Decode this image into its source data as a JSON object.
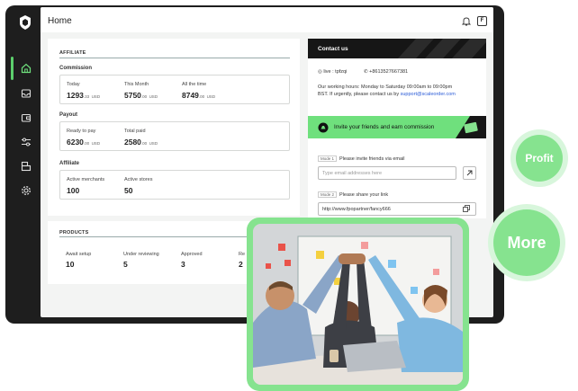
{
  "header": {
    "title": "Home",
    "profile_initial": "F"
  },
  "sidebar": {
    "items": [
      {
        "icon": "home-icon",
        "active": true
      },
      {
        "icon": "inbox-icon",
        "active": false
      },
      {
        "icon": "wallet-icon",
        "active": false
      },
      {
        "icon": "sliders-icon",
        "active": false
      },
      {
        "icon": "store-icon",
        "active": false
      },
      {
        "icon": "gear-icon",
        "active": false
      }
    ]
  },
  "affiliate": {
    "section_title": "AFFILIATE",
    "commission": {
      "title": "Commission",
      "items": [
        {
          "label": "Today",
          "amount": "1293",
          "decimals": ".33",
          "currency": "USD"
        },
        {
          "label": "This Month",
          "amount": "5750",
          "decimals": ".00",
          "currency": "USD"
        },
        {
          "label": "All the time",
          "amount": "8749",
          "decimals": ".00",
          "currency": "USD"
        }
      ]
    },
    "payout": {
      "title": "Payout",
      "items": [
        {
          "label": "Ready to pay",
          "amount": "6230",
          "decimals": ".00",
          "currency": "USD"
        },
        {
          "label": "Total paid",
          "amount": "2580",
          "decimals": ".00",
          "currency": "USD"
        }
      ]
    },
    "stats": {
      "title": "Affiliate",
      "items": [
        {
          "label": "Active merchants",
          "value": "100"
        },
        {
          "label": "Active stores",
          "value": "50"
        }
      ]
    }
  },
  "products": {
    "section_title": "PRODUCTS",
    "items": [
      {
        "label": "Await setup",
        "value": "10"
      },
      {
        "label": "Under reviewing",
        "value": "5"
      },
      {
        "label": "Approved",
        "value": "3"
      },
      {
        "label": "Re",
        "value": "2"
      }
    ]
  },
  "contact": {
    "title": "Contact us",
    "live": "live : tpfzqi",
    "phone": "+8613527667381",
    "hours_line1": "Our working hours: Monday to Saturday 09:00am to 09:00pm",
    "hours_line2_prefix": "BST. If urgently, please contact us by ",
    "email": "support@scaleorder.com"
  },
  "invite": {
    "title": "Invite your friends and earn commission",
    "mode1_tag": "Mode 1",
    "mode1_text": "Please invite friends via email",
    "email_placeholder": "Type email addresses here",
    "mode2_tag": "Mode 2",
    "mode2_text": "Please share your link",
    "share_link": "http://www.fpopartner/fancy666"
  },
  "bubbles": {
    "profit": "Profit",
    "more": "More"
  },
  "colors": {
    "accent": "#6fe07d",
    "dark": "#1e1e1e",
    "bubble": "#86e38f"
  }
}
